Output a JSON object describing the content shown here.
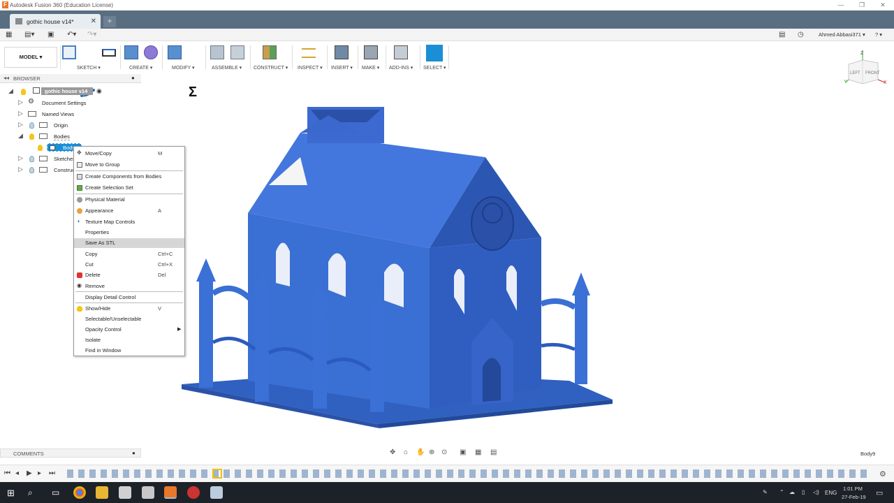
{
  "window": {
    "title": "Autodesk Fusion 360 (Education License)"
  },
  "tabs": {
    "active_label": "gothic house v14*"
  },
  "quickaccess": {
    "user_label": "Ahmed Abbasi371 ▾",
    "help_label": "? ▾"
  },
  "toolbar": {
    "workspace_label": "MODEL ▾",
    "groups": [
      {
        "label": "SKETCH ▾"
      },
      {
        "label": "CREATE ▾"
      },
      {
        "label": "MODIFY ▾"
      },
      {
        "label": "ASSEMBLE ▾"
      },
      {
        "label": "CONSTRUCT ▾"
      },
      {
        "label": "INSPECT ▾"
      },
      {
        "label": "INSERT ▾"
      },
      {
        "label": "MAKE ▾"
      },
      {
        "label": "ADD-INS ▾"
      },
      {
        "label": "SELECT ▾"
      }
    ]
  },
  "browser": {
    "header": "BROWSER",
    "root": "gothic house v14",
    "items": [
      {
        "label": "Document Settings"
      },
      {
        "label": "Named Views"
      },
      {
        "label": "Origin"
      },
      {
        "label": "Bodies"
      },
      {
        "label": "Body9"
      },
      {
        "label": "Sketches"
      },
      {
        "label": "Construction"
      }
    ]
  },
  "context_menu": {
    "items": [
      {
        "label": "Move/Copy",
        "shortcut": "M"
      },
      {
        "label": "Move to Group",
        "shortcut": ""
      },
      {
        "label": "Create Components from Bodies",
        "shortcut": ""
      },
      {
        "label": "Create Selection Set",
        "shortcut": ""
      },
      {
        "label": "Physical Material",
        "shortcut": ""
      },
      {
        "label": "Appearance",
        "shortcut": "A"
      },
      {
        "label": "Texture Map Controls",
        "shortcut": ""
      },
      {
        "label": "Properties",
        "shortcut": ""
      },
      {
        "label": "Save As STL",
        "shortcut": ""
      },
      {
        "label": "Copy",
        "shortcut": "Ctrl+C"
      },
      {
        "label": "Cut",
        "shortcut": "Ctrl+X"
      },
      {
        "label": "Delete",
        "shortcut": "Del"
      },
      {
        "label": "Remove",
        "shortcut": ""
      },
      {
        "label": "Display Detail Control",
        "shortcut": ""
      },
      {
        "label": "Show/Hide",
        "shortcut": "V"
      },
      {
        "label": "Selectable/Unselectable",
        "shortcut": ""
      },
      {
        "label": "Opacity Control",
        "shortcut": ""
      },
      {
        "label": "Isolate",
        "shortcut": ""
      },
      {
        "label": "Find in Window",
        "shortcut": ""
      }
    ],
    "highlighted": "Save As STL"
  },
  "viewcube": {
    "top_label": "Z",
    "left_label": "LEFT",
    "front_label": "FRONT",
    "x_label": "X",
    "y_label": "Y"
  },
  "status": {
    "comments_label": "COMMENTS",
    "selection_label": "Body9"
  },
  "taskbar": {
    "lang": "ENG",
    "time": "1:01 PM",
    "date": "27-Feb-19"
  },
  "colors": {
    "model_blue": "#3c6fd0",
    "select_blue": "#1a8fd6",
    "tab_bar": "#596e80"
  }
}
